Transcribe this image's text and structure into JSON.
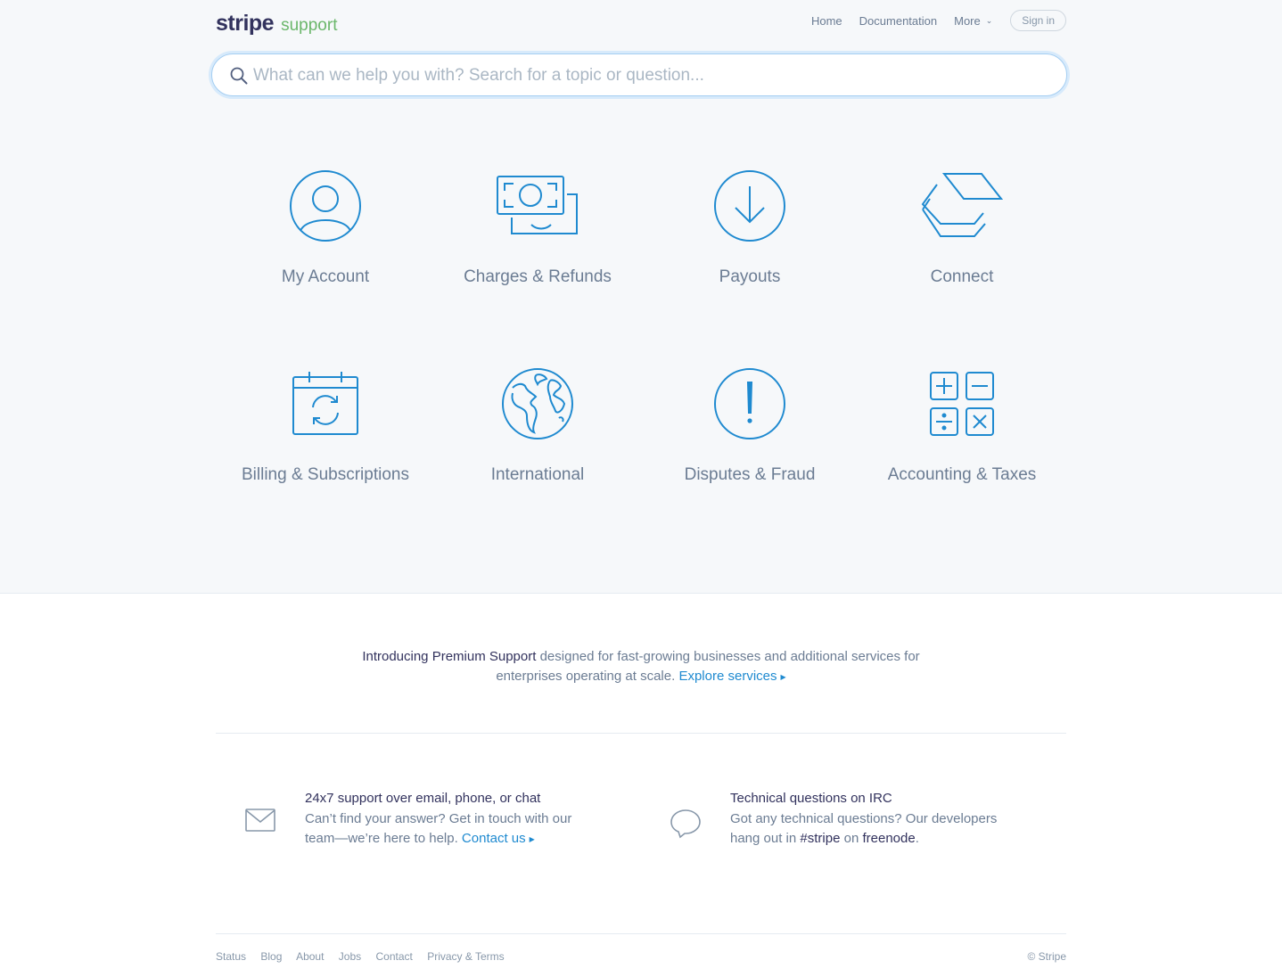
{
  "header": {
    "brand": "stripe",
    "sub": "support",
    "nav": [
      "Home",
      "Documentation",
      "More"
    ],
    "signin": "Sign in"
  },
  "search": {
    "placeholder": "What can we help you with? Search for a topic or question..."
  },
  "categories": [
    {
      "label": "My Account",
      "icon": "user-icon"
    },
    {
      "label": "Charges & Refunds",
      "icon": "money-icon"
    },
    {
      "label": "Payouts",
      "icon": "arrow-down-icon"
    },
    {
      "label": "Connect",
      "icon": "layers-icon"
    },
    {
      "label": "Billing & Subscriptions",
      "icon": "calendar-refresh-icon"
    },
    {
      "label": "International",
      "icon": "globe-icon"
    },
    {
      "label": "Disputes & Fraud",
      "icon": "alert-icon"
    },
    {
      "label": "Accounting & Taxes",
      "icon": "calculator-icon"
    }
  ],
  "premium": {
    "strong": "Introducing Premium Support",
    "text": " designed for fast-growing businesses and additional services for enterprises operating at scale. ",
    "link": "Explore services"
  },
  "support": {
    "email": {
      "title": "24x7 support over email, phone, or chat",
      "text": "Can’t find your answer? Get in touch with our team—we’re here to help. ",
      "link": "Contact us"
    },
    "irc": {
      "title": "Technical questions on IRC",
      "text1": "Got any technical questions? Our developers hang out in ",
      "channel": "#stripe",
      "text2": " on ",
      "network": "freenode",
      "text3": "."
    }
  },
  "footer": {
    "links": [
      "Status",
      "Blog",
      "About",
      "Jobs",
      "Contact",
      "Privacy & Terms"
    ],
    "copyright": "© Stripe"
  },
  "colors": {
    "accent": "#1f8ad0",
    "brand": "#32325d",
    "support_green": "#6bb76b"
  }
}
